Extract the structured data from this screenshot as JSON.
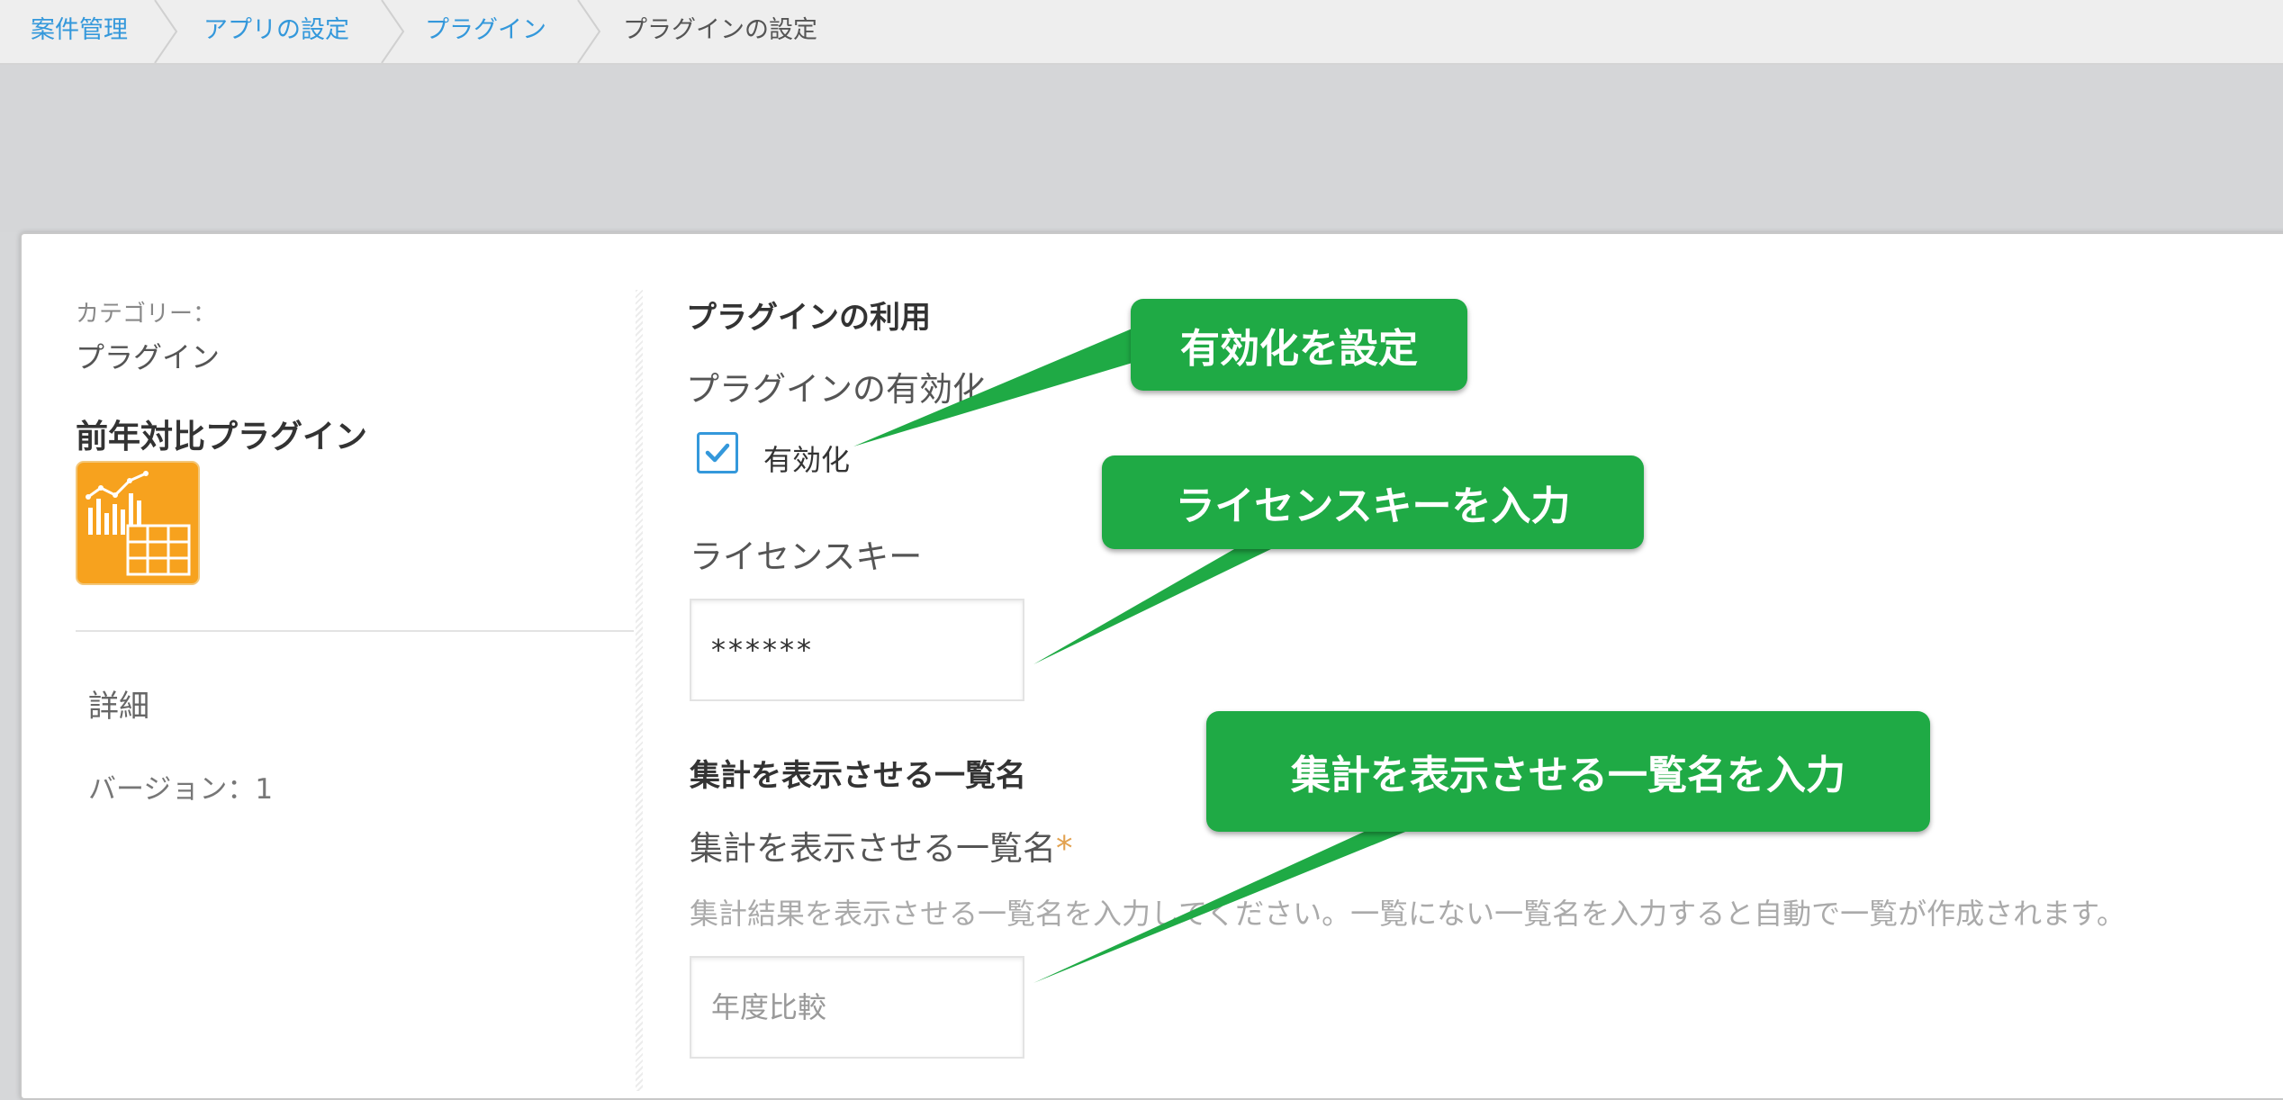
{
  "breadcrumb": {
    "items": [
      "案件管理",
      "アプリの設定",
      "プラグイン"
    ],
    "current": "プラグインの設定"
  },
  "sidebar": {
    "category_label": "カテゴリー：",
    "category_value": "プラグイン",
    "plugin_name": "前年対比プラグイン",
    "plugin_icon": "chart-table-icon",
    "details_label": "詳細",
    "version_label": "バージョン：1"
  },
  "main": {
    "usage_section_title": "プラグインの利用",
    "enable_field_label": "プラグインの有効化",
    "enable_checkbox_label": "有効化",
    "enable_checked": true,
    "license_label": "ライセンスキー",
    "license_value": "******",
    "list_section_title": "集計を表示させる一覧名",
    "list_field_label": "集計を表示させる一覧名",
    "required_mark": "*",
    "list_help_text": "集計結果を表示させる一覧名を入力してください。一覧にない一覧名を入力すると自動で一覧が作成されます。",
    "list_input_placeholder": "年度比較"
  },
  "callouts": {
    "enable": "有効化を設定",
    "license": "ライセンスキーを入力",
    "list_name": "集計を表示させる一覧名を入力"
  },
  "colors": {
    "link": "#3498db",
    "callout_green": "#1faa45",
    "plugin_icon_orange": "#f7a21e",
    "required": "#e2a250"
  }
}
